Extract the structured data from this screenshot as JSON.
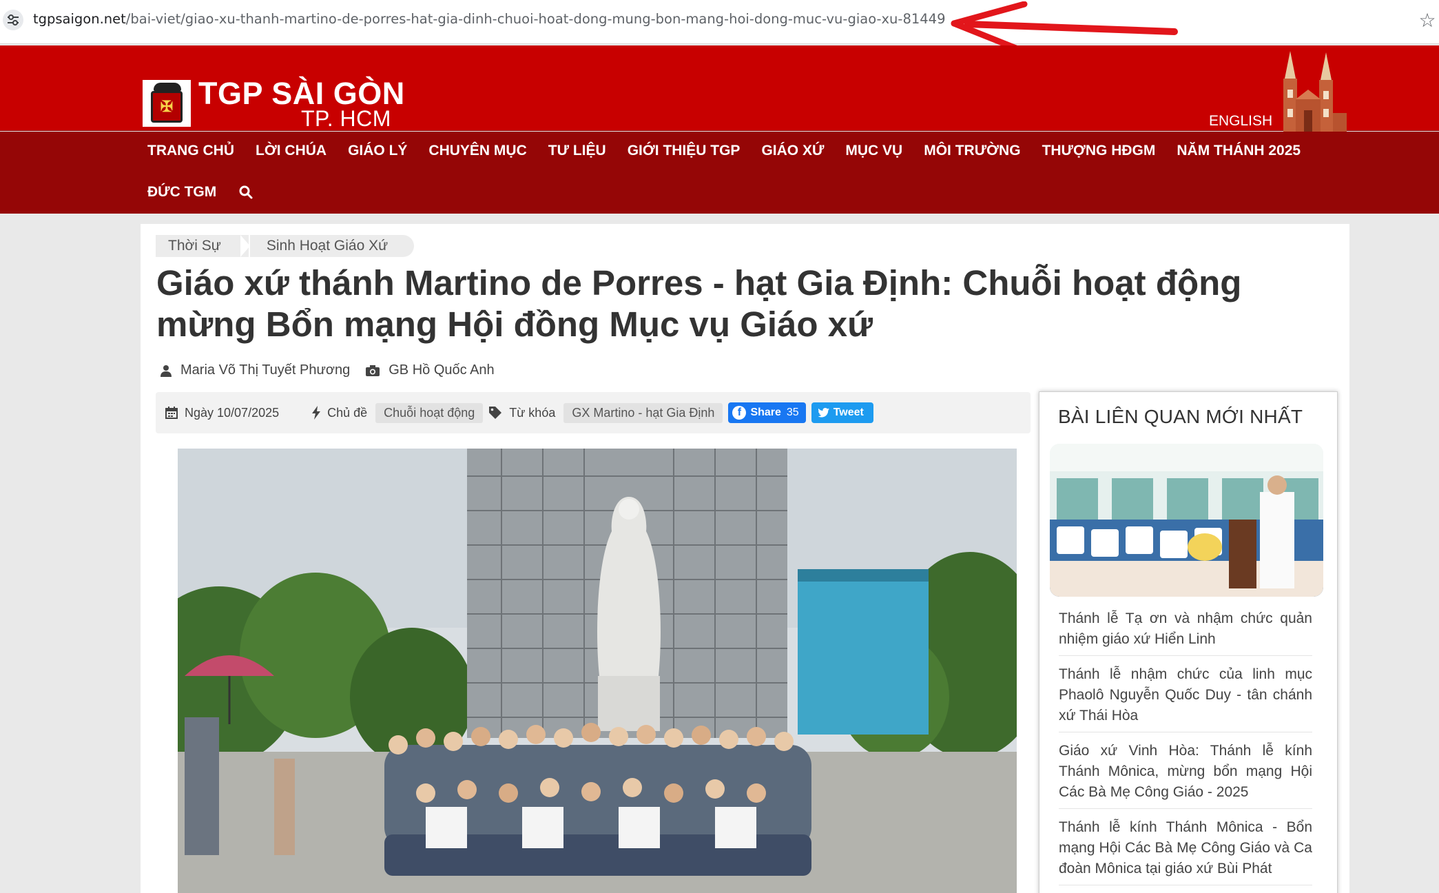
{
  "browser": {
    "url_host": "tgpsaigon.net",
    "url_path": "/bai-viet/giao-xu-thanh-martino-de-porres-hat-gia-dinh-chuoi-hoat-dong-mung-bon-mang-hoi-dong-muc-vu-giao-xu-81449",
    "icons": {
      "site_info": "tune-icon",
      "bookmark": "star-icon",
      "annotation": "red-arrow"
    }
  },
  "header": {
    "brand_title": "TGP SÀI GÒN",
    "brand_subtitle": "TP. HCM",
    "english_label": "ENGLISH",
    "colors": {
      "header_red": "#c80000",
      "nav_red": "#950606"
    }
  },
  "nav": {
    "row1": [
      "TRANG CHỦ",
      "LỜI CHÚA",
      "GIÁO LÝ",
      "CHUYÊN MỤC",
      "TƯ LIỆU",
      "GIỚI THIỆU TGP",
      "GIÁO XỨ",
      "MỤC VỤ",
      "MÔI TRƯỜNG",
      "THƯỢNG HĐGM",
      "NĂM THÁNH 2025"
    ],
    "row2": [
      "ĐỨC TGM"
    ],
    "search_icon": "search-icon"
  },
  "article": {
    "breadcrumbs": [
      "Thời Sự",
      "Sinh Hoạt Giáo Xứ"
    ],
    "title": "Giáo xứ thánh Martino de Porres - hạt Gia Định: Chuỗi hoạt động mừng Bổn mạng Hội đồng Mục vụ Giáo xứ",
    "author": "Maria Võ Thị Tuyết Phương",
    "photographer": "GB Hồ Quốc Anh",
    "date": "Ngày 10/07/2025",
    "topic_label": "Chủ đề",
    "topic_value": "Chuỗi hoạt động",
    "keyword_label": "Từ khóa",
    "keyword_value": "GX Martino - hạt Gia Định",
    "share_label": "Share",
    "share_count": "35",
    "tweet_label": "Tweet"
  },
  "sidebar": {
    "title": "BÀI LIÊN QUAN MỚI NHẤT",
    "items": [
      "Thánh lễ Tạ ơn và nhậm chức quản nhiệm giáo xứ Hiển Linh",
      "Thánh lễ nhậm chức của linh mục Phaolô Nguyễn Quốc Duy - tân chánh xứ Thái Hòa",
      "Giáo xứ Vinh Hòa: Thánh lễ kính Thánh Mônica, mừng bổn mạng Hội Các Bà Mẹ Công Giáo - 2025",
      "Thánh lễ kính Thánh Mônica - Bổn mạng Hội Các Bà Mẹ Công Giáo và Ca đoàn Mônica tại giáo xứ Bùi Phát"
    ]
  }
}
